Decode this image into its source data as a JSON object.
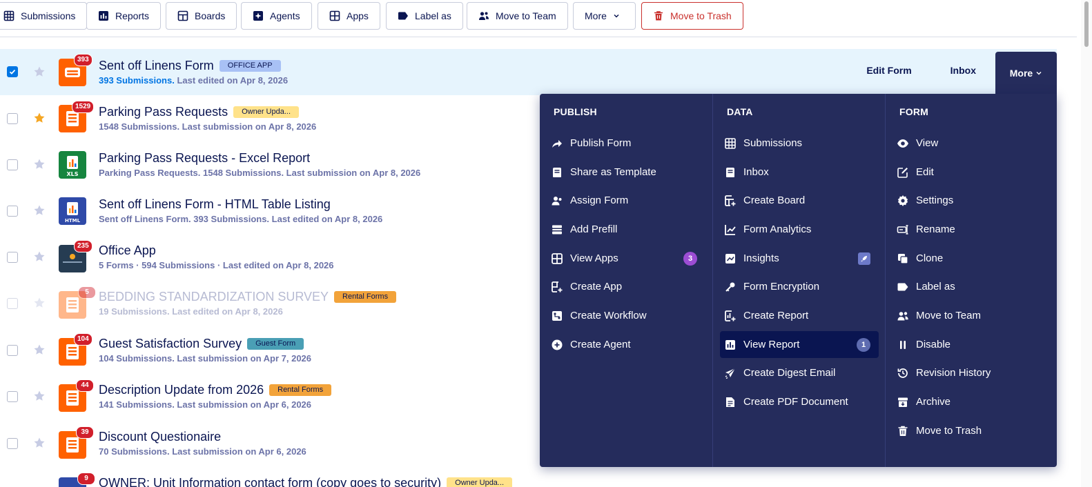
{
  "colors": {
    "navy": "#0a1551",
    "menu_bg": "#252c5c",
    "accent_blue": "#0075e3",
    "badge_red": "#d11f2b",
    "trash_red": "#c9302c",
    "orange": "#ff6100",
    "star_gold": "#f5a623"
  },
  "toolbar": {
    "submissions": "Submissions",
    "reports": "Reports",
    "boards": "Boards",
    "agents": "Agents",
    "apps": "Apps",
    "label_as": "Label as",
    "move_to_team": "Move to Team",
    "more": "More",
    "move_to_trash": "Move to Trash"
  },
  "rows": [
    {
      "title": "Sent off Linens Form",
      "tag": "OFFICE APP",
      "sub_highlight": "393 Submissions.",
      "sub": "Last edited on Apr 8, 2026",
      "badge": "393",
      "icon": "form-icon",
      "starred": false,
      "selected": true
    },
    {
      "title": "Parking Pass Requests",
      "tag": "Owner Upda...",
      "sub": "1548 Submissions. Last submission on Apr 8, 2026",
      "badge": "1529",
      "icon": "form-icon",
      "starred": true
    },
    {
      "title": "Parking Pass Requests - Excel Report",
      "sub": "Parking Pass Requests. 1548 Submissions. Last submission on Apr 8, 2026",
      "icon_label": "XLS",
      "icon": "excel-report-icon"
    },
    {
      "title": "Sent off Linens Form - HTML Table Listing",
      "sub": "Sent off Linens Form. 393 Submissions. Last edited on Apr 8, 2026",
      "icon_label": "HTML",
      "icon": "html-report-icon"
    },
    {
      "title": "Office App",
      "sub": "5 Forms · 594 Submissions · Last edited on Apr 8, 2026",
      "badge": "235",
      "icon": "app-icon"
    },
    {
      "title": "BEDDING STANDARDIZATION SURVEY",
      "tag": "Rental Forms",
      "sub": "19 Submissions. Last edited on Apr 8, 2026",
      "badge": "5",
      "icon": "form-icon",
      "disabled": true
    },
    {
      "title": "Guest Satisfaction Survey",
      "tag": "Guest Form",
      "sub": "104 Submissions. Last submission on Apr 7, 2026",
      "badge": "104",
      "icon": "form-icon"
    },
    {
      "title": "Description Update from 2026",
      "tag": "Rental Forms",
      "sub": "141 Submissions. Last submission on Apr 6, 2026",
      "badge": "44",
      "icon": "form-icon"
    },
    {
      "title": "Discount Questionaire",
      "sub": "70 Submissions. Last submission on Apr 6, 2026",
      "badge": "39",
      "icon": "form-icon"
    },
    {
      "title": "OWNER: Unit Information contact form (copy goes to security)",
      "tag": "Owner Upda...",
      "badge": "9",
      "icon": "form-icon"
    }
  ],
  "row_actions": {
    "edit_form": "Edit Form",
    "inbox": "Inbox",
    "more": "More"
  },
  "menu": {
    "publish": {
      "heading": "PUBLISH",
      "items": [
        "Publish Form",
        "Share as Template",
        "Assign Form",
        "Add Prefill",
        "View Apps",
        "Create App",
        "Create Workflow",
        "Create Agent"
      ],
      "view_apps_count": "3"
    },
    "data": {
      "heading": "DATA",
      "items": [
        "Submissions",
        "Inbox",
        "Create Board",
        "Form Analytics",
        "Insights",
        "Form Encryption",
        "Create Report",
        "View Report",
        "Create Digest Email",
        "Create PDF Document"
      ],
      "view_report_count": "1"
    },
    "form": {
      "heading": "FORM",
      "items": [
        "View",
        "Edit",
        "Settings",
        "Rename",
        "Clone",
        "Label as",
        "Move to Team",
        "Disable",
        "Revision History",
        "Archive",
        "Move to Trash"
      ]
    }
  }
}
